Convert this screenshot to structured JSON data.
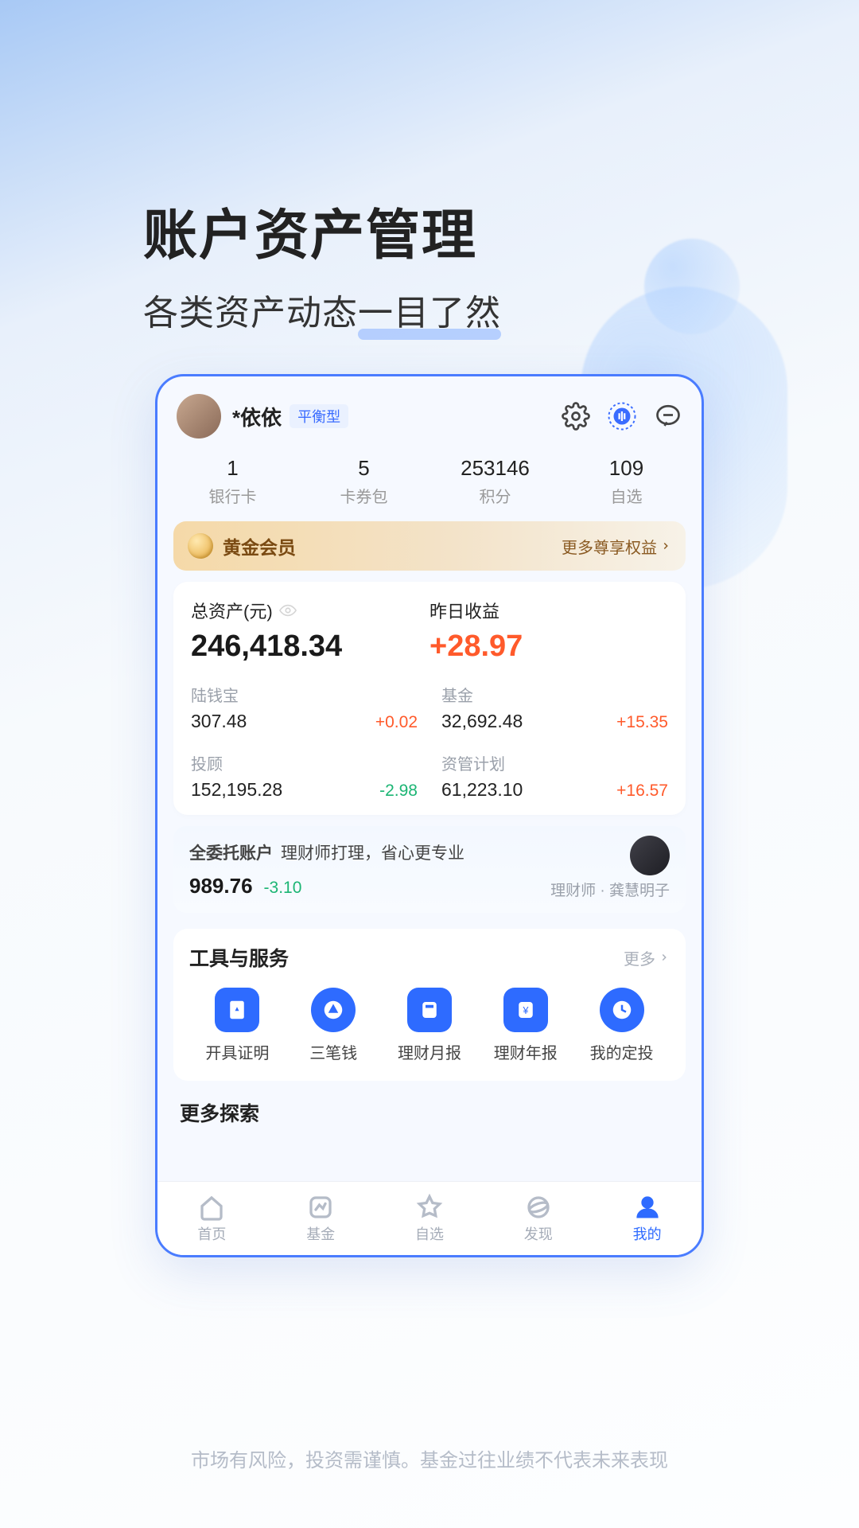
{
  "hero": {
    "title": "账户资产管理",
    "subtitle": "各类资产动态一目了然"
  },
  "user": {
    "name": "*依依",
    "tag": "平衡型"
  },
  "stats": [
    {
      "value": "1",
      "label": "银行卡"
    },
    {
      "value": "5",
      "label": "卡券包"
    },
    {
      "value": "253146",
      "label": "积分"
    },
    {
      "value": "109",
      "label": "自选"
    }
  ],
  "gold": {
    "title": "黄金会员",
    "more": "更多尊享权益"
  },
  "assets": {
    "total_label": "总资产(元)",
    "total_value": "246,418.34",
    "profit_label": "昨日收益",
    "profit_value": "+28.97"
  },
  "holdings": [
    {
      "label": "陆钱宝",
      "value": "307.48",
      "change": "+0.02",
      "cls": "red"
    },
    {
      "label": "基金",
      "value": "32,692.48",
      "change": "+15.35",
      "cls": "red"
    },
    {
      "label": "投顾",
      "value": "152,195.28",
      "change": "-2.98",
      "cls": "green"
    },
    {
      "label": "资管计划",
      "value": "61,223.10",
      "change": "+16.57",
      "cls": "red"
    }
  ],
  "trust": {
    "title": "全委托账户",
    "desc": "理财师打理，省心更专业",
    "value": "989.76",
    "change": "-3.10",
    "advisor": "理财师 · 龚慧明子"
  },
  "tools": {
    "title": "工具与服务",
    "more": "更多",
    "items": [
      {
        "label": "开具证明"
      },
      {
        "label": "三笔钱"
      },
      {
        "label": "理财月报"
      },
      {
        "label": "理财年报"
      },
      {
        "label": "我的定投"
      }
    ]
  },
  "explore": {
    "title": "更多探索"
  },
  "tabs": [
    {
      "label": "首页"
    },
    {
      "label": "基金"
    },
    {
      "label": "自选"
    },
    {
      "label": "发现"
    },
    {
      "label": "我的"
    }
  ],
  "disclaimer": "市场有风险，投资需谨慎。基金过往业绩不代表未来表现"
}
